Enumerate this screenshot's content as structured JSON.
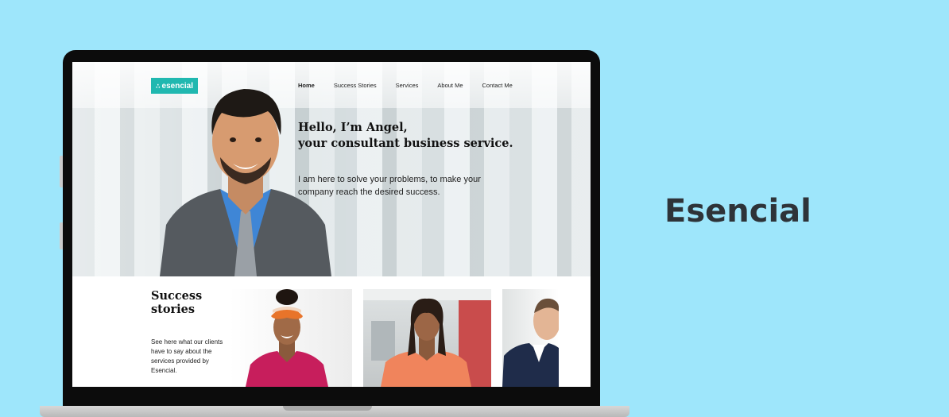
{
  "brand_title": "Esencial",
  "site": {
    "logo_text": "esencial",
    "nav": [
      "Home",
      "Success Stories",
      "Services",
      "About Me",
      "Contact Me"
    ],
    "hero": {
      "title_line1": "Hello, I’m Angel,",
      "title_line2": "your consultant business service.",
      "text": "I am here to solve your problems, to make your company reach the desired success."
    },
    "success": {
      "title_line1": "Success",
      "title_line2": "stories",
      "text": "See here what our clients have to say about the services provided by Esencial."
    }
  },
  "colors": {
    "background": "#9ee6fb",
    "logo": "#20b8b0",
    "brand_text": "#2e3338"
  }
}
